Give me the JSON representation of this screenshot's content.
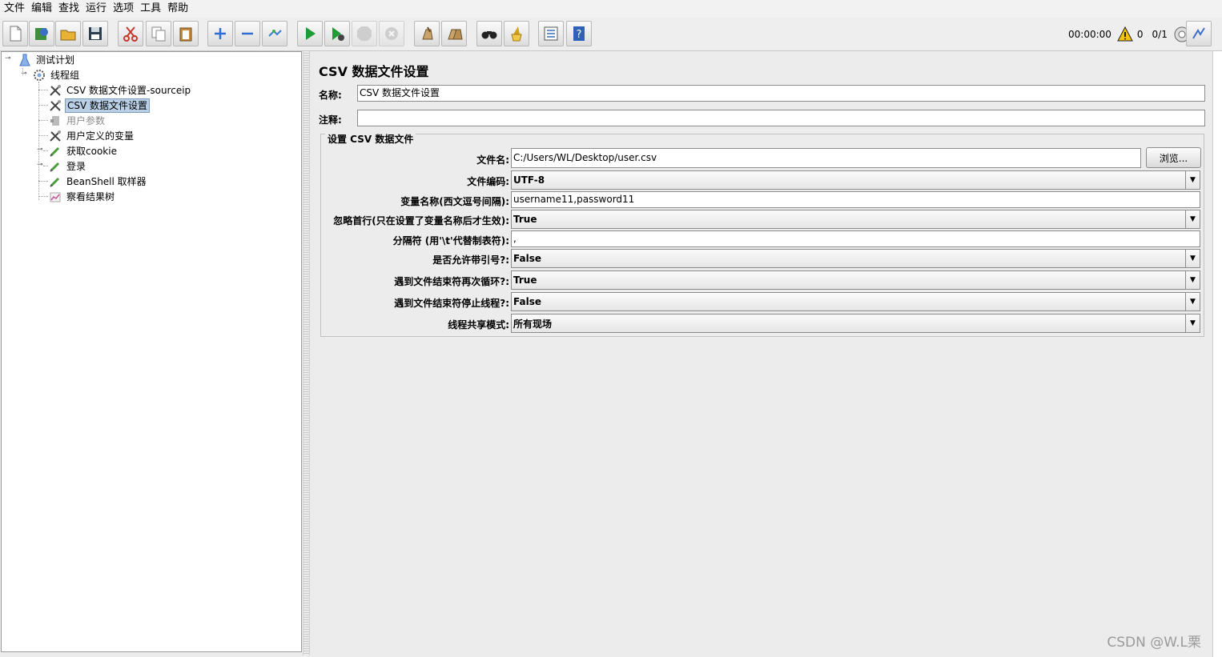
{
  "menu": [
    "文件",
    "编辑",
    "查找",
    "运行",
    "选项",
    "工具",
    "帮助"
  ],
  "toolbar": {
    "buttons": [
      {
        "name": "new-icon"
      },
      {
        "name": "templates-icon"
      },
      {
        "name": "open-icon"
      },
      {
        "name": "save-icon"
      },
      {
        "name": "cut-icon"
      },
      {
        "name": "copy-icon"
      },
      {
        "name": "paste-icon"
      },
      {
        "name": "expand-icon"
      },
      {
        "name": "collapse-icon"
      },
      {
        "name": "toggle-icon"
      },
      {
        "name": "start-icon"
      },
      {
        "name": "start-no-pause-icon"
      },
      {
        "name": "stop-icon"
      },
      {
        "name": "shutdown-icon"
      },
      {
        "name": "clear-icon"
      },
      {
        "name": "clear-all-icon"
      },
      {
        "name": "search-icon"
      },
      {
        "name": "reset-search-icon"
      },
      {
        "name": "function-helper-icon"
      },
      {
        "name": "help-icon"
      }
    ],
    "timer": "00:00:00",
    "warning_count": "0",
    "threads": "0/1"
  },
  "tree": {
    "nodes": [
      {
        "label": "测试计划",
        "icon": "test-plan-icon"
      },
      {
        "label": "线程组",
        "icon": "thread-group-icon"
      },
      {
        "label": "CSV 数据文件设置-sourceip",
        "icon": "config-element-icon"
      },
      {
        "label": "CSV 数据文件设置",
        "icon": "config-element-icon",
        "selected": true
      },
      {
        "label": "用户参数",
        "icon": "preprocessor-icon",
        "disabled": true
      },
      {
        "label": "用户定义的变量",
        "icon": "config-element-icon"
      },
      {
        "label": "获取cookie",
        "icon": "sampler-icon"
      },
      {
        "label": "登录",
        "icon": "sampler-icon"
      },
      {
        "label": "BeanShell 取样器",
        "icon": "sampler-icon"
      },
      {
        "label": "察看结果树",
        "icon": "listener-icon"
      }
    ]
  },
  "panel": {
    "title": "CSV 数据文件设置",
    "name_label": "名称:",
    "name_value": "CSV 数据文件设置",
    "comment_label": "注释:",
    "comment_value": "",
    "group_title": "设置 CSV 数据文件",
    "filename_label": "文件名:",
    "filename_value": "C:/Users/WL/Desktop/user.csv",
    "browse_label": "浏览...",
    "encoding_label": "文件编码:",
    "encoding_value": "UTF-8",
    "varnames_label": "变量名称(西文逗号间隔):",
    "varnames_value": "username11,password11",
    "ignore_first_label": "忽略首行(只在设置了变量名称后才生效):",
    "ignore_first_value": "True",
    "delimiter_label": "分隔符 (用'\\t'代替制表符):",
    "delimiter_value": ",",
    "quoted_label": "是否允许带引号?:",
    "quoted_value": "False",
    "recycle_label": "遇到文件结束符再次循环?:",
    "recycle_value": "True",
    "stop_thread_label": "遇到文件结束符停止线程?:",
    "stop_thread_value": "False",
    "sharing_label": "线程共享模式:",
    "sharing_value": "所有现场"
  },
  "watermark": "CSDN @W.L栗"
}
